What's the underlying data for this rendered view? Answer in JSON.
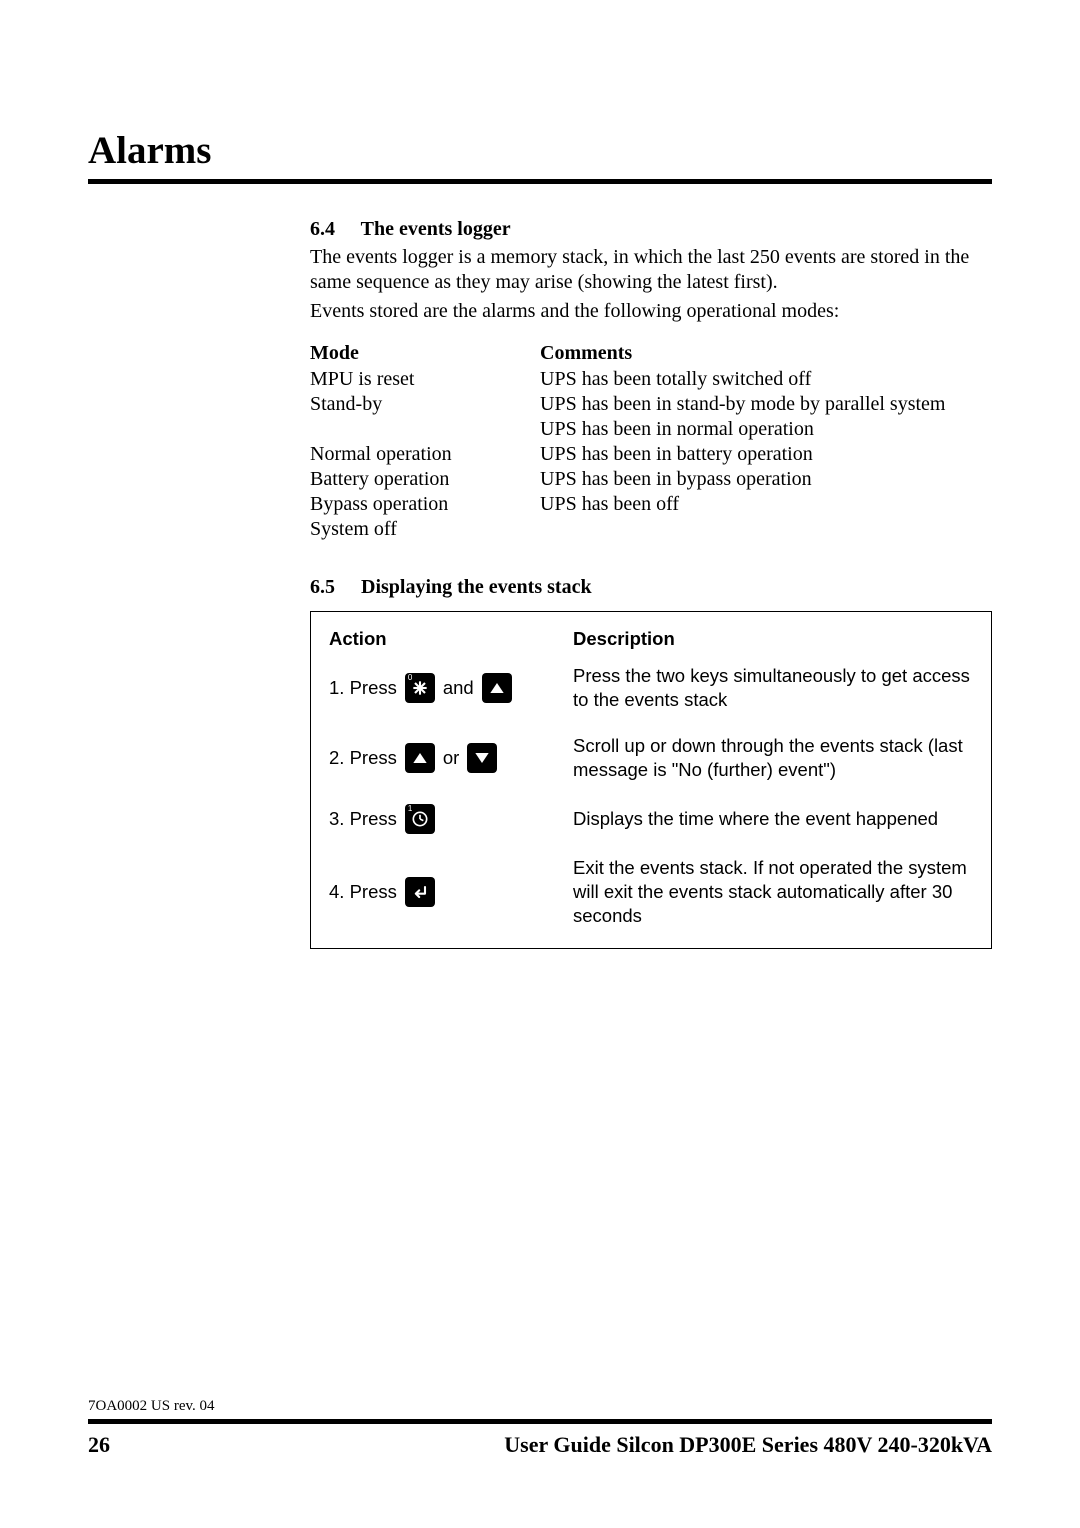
{
  "chapter_title": "Alarms",
  "section64": {
    "num": "6.4",
    "title": "The events logger",
    "p1": "The events logger is a memory stack, in which the last 250 events are stored in the same sequence as they may arise (showing the latest first).",
    "p2": "Events stored are the alarms and the following operational modes:"
  },
  "mode_table": {
    "head_mode": "Mode",
    "head_comments": "Comments",
    "rows": [
      {
        "mode": "MPU is reset",
        "comment": "UPS has been totally switched off"
      },
      {
        "mode": "Stand-by",
        "comment": "UPS has been in stand-by mode by parallel system"
      },
      {
        "mode": "Normal operation",
        "comment": "UPS has been in normal operation"
      },
      {
        "mode": "Battery operation",
        "comment": "UPS has been in battery operation"
      },
      {
        "mode": "Bypass operation",
        "comment": "UPS has been in bypass operation"
      },
      {
        "mode": "System off",
        "comment": "UPS has been off"
      }
    ]
  },
  "section65": {
    "num": "6.5",
    "title": "Displaying the events stack"
  },
  "stack": {
    "head_action": "Action",
    "head_desc": "Description",
    "rows": [
      {
        "label": "1. Press",
        "conj": "and",
        "key1_name": "asterisk-0-key",
        "key1_corner": "0",
        "key2_name": "up-key",
        "desc": "Press the two keys simultaneously to get access to the events stack"
      },
      {
        "label": "2. Press",
        "conj": "or",
        "key1_name": "up-key",
        "key2_name": "down-key",
        "desc": "Scroll up or down through the events stack (last message is \"No (further) event\")"
      },
      {
        "label": "3. Press",
        "key1_name": "clock-1-key",
        "key1_corner": "1",
        "desc": "Displays the time where the event happened"
      },
      {
        "label": "4. Press",
        "key1_name": "enter-key",
        "desc": "Exit the events stack. If not operated the system will exit the events stack automatically after 30 seconds"
      }
    ]
  },
  "footer": {
    "docrev": "7OA0002 US rev. 04",
    "page_num": "26",
    "guide_title": "User Guide Silcon DP300E Series 480V 240-320kVA"
  }
}
